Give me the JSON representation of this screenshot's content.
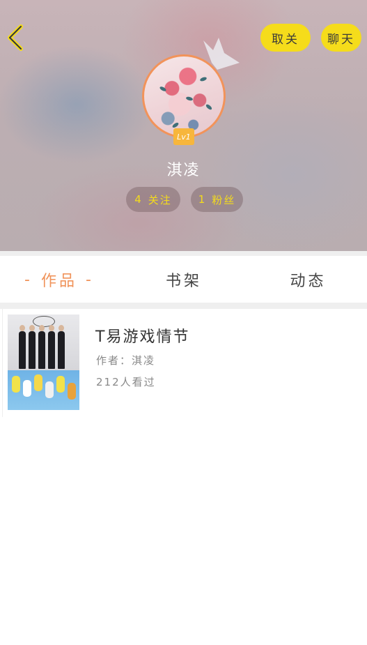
{
  "header": {
    "unfollow_label": "取关",
    "chat_label": "聊天",
    "level": "Lv1",
    "username": "淇凌",
    "following_count": "4",
    "following_label": "关注",
    "followers_count": "1",
    "followers_label": "粉丝"
  },
  "tabs": [
    {
      "label": "作品",
      "active": true
    },
    {
      "label": "书架",
      "active": false
    },
    {
      "label": "动态",
      "active": false
    }
  ],
  "books": [
    {
      "title": "T易游戏情节",
      "author": "作者：淇凌",
      "views": "212人看过"
    }
  ],
  "colors": {
    "accent_yellow": "#f5dc1b",
    "accent_orange": "#f0935a",
    "level_badge": "#f7b63c"
  },
  "icons": {
    "back": "chevron-left-icon",
    "crown": "crown-icon"
  }
}
